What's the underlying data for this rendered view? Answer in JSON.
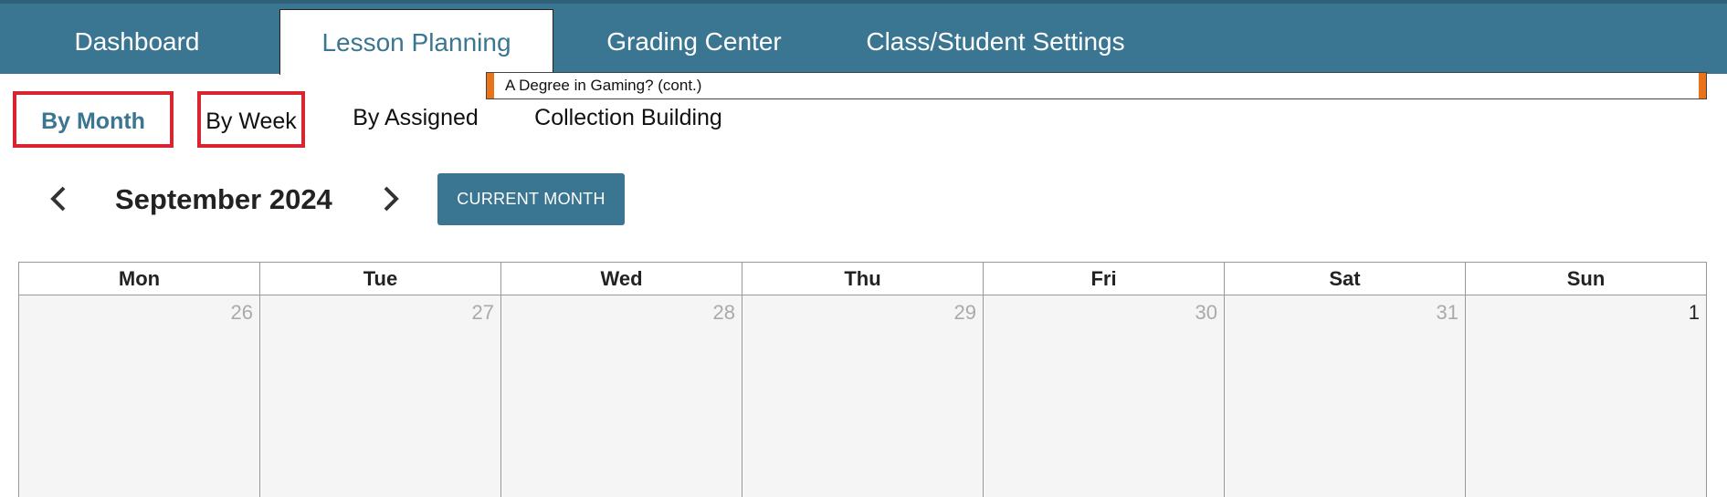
{
  "top_nav": {
    "tabs": [
      {
        "label": "Dashboard"
      },
      {
        "label": "Lesson Planning"
      },
      {
        "label": "Grading Center"
      },
      {
        "label": "Class/Student Settings"
      }
    ],
    "active_index": 1
  },
  "sub_nav": {
    "items": [
      {
        "label": "By Month"
      },
      {
        "label": "By Week"
      },
      {
        "label": "By Assigned"
      },
      {
        "label": "Collection Building"
      }
    ],
    "active_index": 0
  },
  "month_nav": {
    "title": "September 2024",
    "prev_icon": "chevron-left-icon",
    "next_icon": "chevron-right-icon",
    "current_button": "CURRENT MONTH"
  },
  "calendar": {
    "weekdays": [
      "Mon",
      "Tue",
      "Wed",
      "Thu",
      "Fri",
      "Sat",
      "Sun"
    ],
    "days": [
      "26",
      "27",
      "28",
      "29",
      "30",
      "31",
      "1"
    ],
    "event": {
      "title": "A Degree in Gaming? (cont.)",
      "color": "#e8731a"
    }
  },
  "colors": {
    "brand": "#3a7691",
    "highlight_outline": "#d9252f",
    "muted_day": "#aaaaaa"
  }
}
